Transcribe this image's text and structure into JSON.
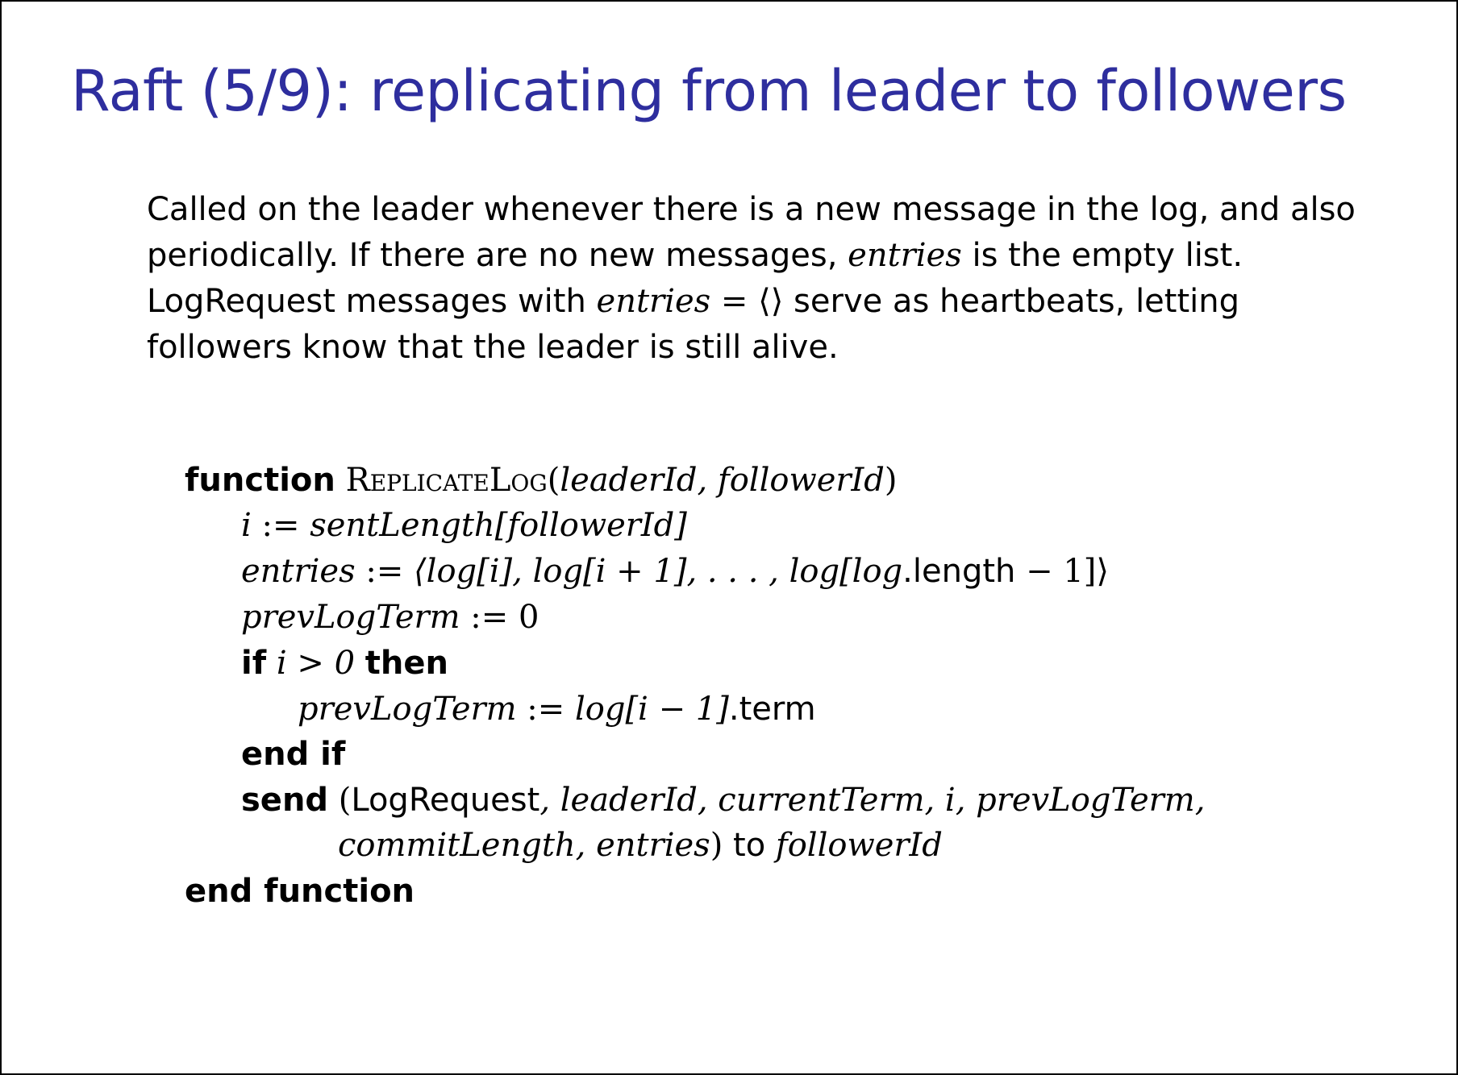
{
  "colors": {
    "title": "#2e2e9e",
    "text": "#000000",
    "border": "#000000",
    "background": "#ffffff"
  },
  "slide": {
    "title": "Raft (5/9): replicating from leader to followers"
  },
  "intro": {
    "line1": "Called on the leader whenever there is a new message in the log, and also",
    "line2_a": "periodically. If there are no new messages, ",
    "line2_var": "entries",
    "line2_b": " is the empty list.",
    "line3_a": "LogRequest messages with ",
    "line3_var": "entries",
    "line3_eq": " = ⟨⟩",
    "line3_b": " serve as heartbeats, letting",
    "line4": "followers know that the leader is still alive."
  },
  "algorithm": {
    "keywords": {
      "function": "function",
      "if": "if",
      "then": "then",
      "end_if": "end if",
      "send": "send",
      "end_function": "end function"
    },
    "lines": {
      "header_name": "ReplicateLog",
      "header_paren_open": "(",
      "header_args": "leaderId, followerId",
      "header_paren_close": ")",
      "assign_i_var": "i",
      "assign_i_op": " := ",
      "assign_i_expr": "sentLength[followerId]",
      "entries_var": "entries",
      "entries_op": " := ",
      "entries_expr_a": "⟨log[i], log[i + 1], . . . , log[log",
      "entries_length": ".length",
      "entries_expr_b": " − 1]⟩",
      "prev_var": "prevLogTerm",
      "prev_op": " := ",
      "prev_value": "0",
      "if_cond": "i > 0",
      "prev2_var": "prevLogTerm",
      "prev2_op": " := ",
      "prev2_expr": "log[i − 1]",
      "prev2_term": ".term",
      "send_open": "(",
      "send_msg": "LogRequest",
      "send_args1": ", leaderId, currentTerm, i, prevLogTerm,",
      "send_args2": "commitLength, entries",
      "send_close": ")",
      "send_to": " to ",
      "send_target": "followerId"
    }
  }
}
